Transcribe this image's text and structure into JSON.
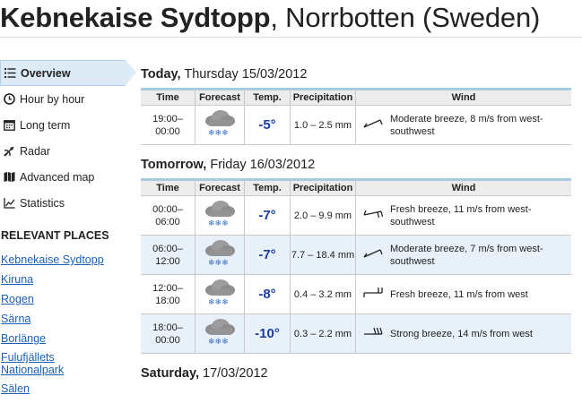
{
  "header": {
    "place_bold": "Kebnekaise Sydtopp",
    "place_rest": ", Norrbotten (Sweden)"
  },
  "sidebar": {
    "items": [
      {
        "label": "Overview",
        "icon": "list-icon",
        "active": true
      },
      {
        "label": "Hour by hour",
        "icon": "clock-icon"
      },
      {
        "label": "Long term",
        "icon": "calendar-icon"
      },
      {
        "label": "Radar",
        "icon": "radar-icon"
      },
      {
        "label": "Advanced map",
        "icon": "map-icon"
      },
      {
        "label": "Statistics",
        "icon": "chart-icon"
      }
    ],
    "places_heading": "RELEVANT PLACES",
    "places": [
      "Kebnekaise Sydtopp",
      "Kiruna",
      "Rogen",
      "Särna",
      "Borlänge",
      "Fulufjällets Nationalpark",
      "Sälen"
    ]
  },
  "columns": {
    "time": "Time",
    "forecast": "Forecast",
    "temp": "Temp.",
    "precip": "Precipitation",
    "wind": "Wind"
  },
  "days": [
    {
      "day_bold": "Today,",
      "day_rest": " Thursday 15/03/2012",
      "rows": [
        {
          "time_from": "19:00–",
          "time_to": "00:00",
          "forecast": "cloud-snow-icon",
          "temp": "-5°",
          "precip": "1.0 – 2.5 mm",
          "wind": "Moderate breeze, 8 m/s from west-southwest"
        }
      ]
    },
    {
      "day_bold": "Tomorrow,",
      "day_rest": " Friday 16/03/2012",
      "rows": [
        {
          "time_from": "00:00–",
          "time_to": "06:00",
          "forecast": "cloud-snow-icon",
          "temp": "-7°",
          "precip": "2.0 – 9.9 mm",
          "wind": "Fresh breeze, 11 m/s from west-southwest"
        },
        {
          "time_from": "06:00–",
          "time_to": "12:00",
          "forecast": "cloud-snow-icon",
          "temp": "-7°",
          "precip": "7.7 – 18.4 mm",
          "wind": "Moderate breeze, 7 m/s from west-southwest"
        },
        {
          "time_from": "12:00–",
          "time_to": "18:00",
          "forecast": "cloud-snow-icon",
          "temp": "-8°",
          "precip": "0.4 – 3.2 mm",
          "wind": "Fresh breeze, 11 m/s from west"
        },
        {
          "time_from": "18:00–",
          "time_to": "00:00",
          "forecast": "cloud-snow-icon",
          "temp": "-10°",
          "precip": "0.3 – 2.2 mm",
          "wind": "Strong breeze, 14 m/s from west"
        }
      ]
    },
    {
      "day_bold": "Saturday,",
      "day_rest": " 17/03/2012",
      "rows": []
    }
  ]
}
